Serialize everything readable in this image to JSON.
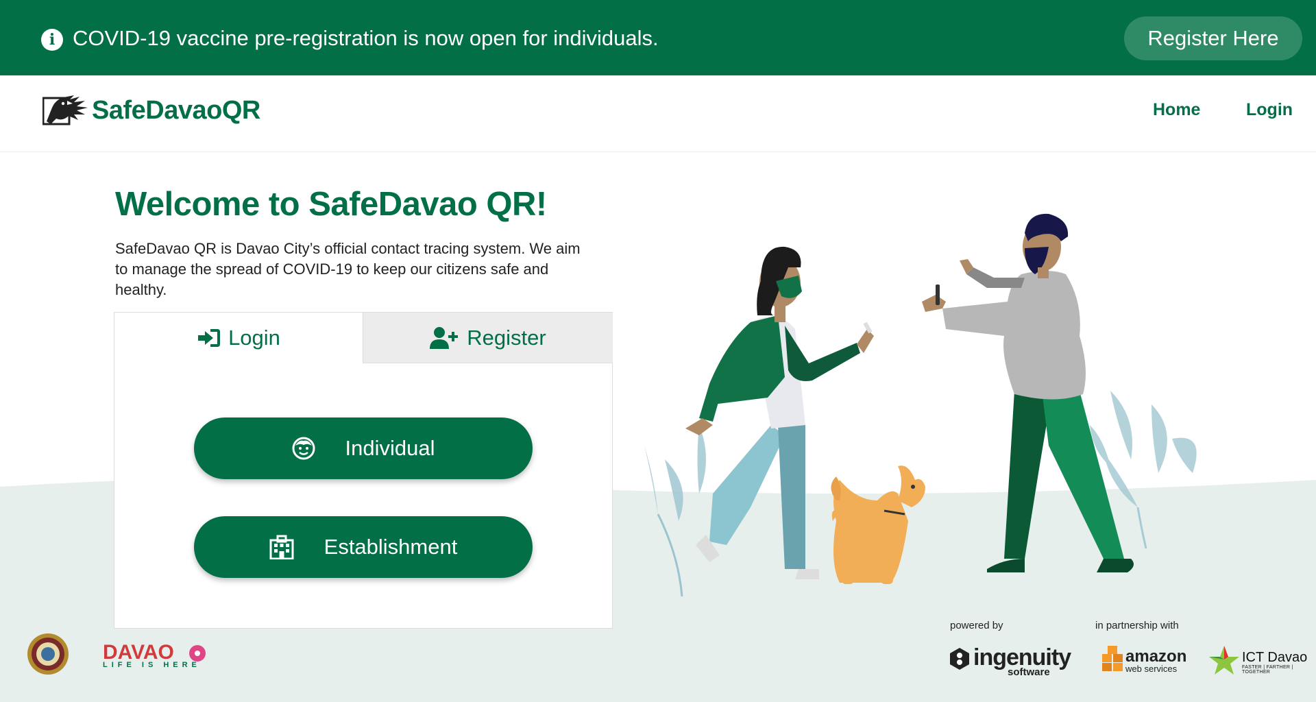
{
  "banner": {
    "message": "COVID-19 vaccine pre-registration is now open for individuals.",
    "info_icon": "i",
    "cta_label": "Register Here",
    "color": "#036f47"
  },
  "header": {
    "brand": "SafeDavaoQR",
    "nav": {
      "home": "Home",
      "login": "Login"
    }
  },
  "hero": {
    "title": "Welcome to SafeDavao QR!",
    "description": "SafeDavao QR is Davao City’s official contact tracing system. We aim to manage the spread of COVID-19 to keep our citizens safe and healthy."
  },
  "auth_card": {
    "tabs": [
      {
        "label": "Login",
        "icon": "sign-in-icon",
        "active": true
      },
      {
        "label": "Register",
        "icon": "user-plus-icon",
        "active": false
      }
    ],
    "options": [
      {
        "label": "Individual",
        "icon": "child-face-icon"
      },
      {
        "label": "Establishment",
        "icon": "building-icon"
      }
    ]
  },
  "footer": {
    "davao_tagline": "LIFE IS HERE",
    "davao_logo_text": "DAVAO",
    "powered_by": "powered by",
    "partnership": "in partnership with",
    "ingenuity": {
      "name": "ingenuity",
      "sub": "software"
    },
    "amazon": {
      "name": "amazon",
      "sub": "web services"
    },
    "ict": {
      "name": "ICT Davao",
      "sub": "FASTER | FARTHER | TOGETHER"
    }
  },
  "colors": {
    "primary": "#036f47",
    "ground": "#e6efec",
    "tab_inactive": "#ececec"
  }
}
